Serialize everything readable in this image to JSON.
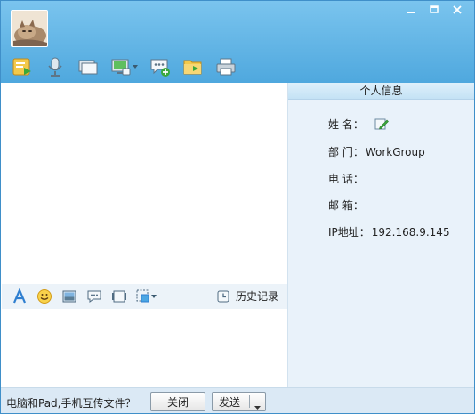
{
  "window": {
    "buttons": [
      {
        "name": "minimize",
        "icon": "minimize-icon"
      },
      {
        "name": "maximize",
        "icon": "maximize-icon"
      },
      {
        "name": "close",
        "icon": "close-icon"
      }
    ]
  },
  "toolbar": {
    "items": [
      {
        "name": "send-file",
        "icon": "file-transfer-icon"
      },
      {
        "name": "voice",
        "icon": "microphone-icon"
      },
      {
        "name": "video",
        "icon": "monitor-icon"
      },
      {
        "name": "remote-desktop",
        "icon": "remote-desktop-icon",
        "has_dropdown": true
      },
      {
        "name": "group-chat",
        "icon": "chat-add-icon"
      },
      {
        "name": "shared-folder",
        "icon": "folder-icon"
      },
      {
        "name": "print",
        "icon": "printer-icon"
      }
    ]
  },
  "input_toolbar": {
    "items": [
      "font-icon",
      "emoji-icon",
      "image-icon",
      "message-icon",
      "screenshot-icon",
      "capture-icon"
    ],
    "history_label": "历史记录"
  },
  "info": {
    "title": "个人信息",
    "name_label": "姓 名：",
    "dept_label": "部 门：",
    "dept_value": "WorkGroup",
    "phone_label": "电 话：",
    "phone_value": "",
    "email_label": "邮 箱：",
    "email_value": "",
    "ip_label": "IP地址：",
    "ip_value": "192.168.9.145"
  },
  "bottom": {
    "tip": "电脑和Pad,手机互传文件？",
    "close_label": "关闭",
    "send_label": "发送"
  },
  "colors": {
    "titlebar": "#5aaee3",
    "panel": "#e9f2fa",
    "bottombar": "#dbe9f5"
  }
}
